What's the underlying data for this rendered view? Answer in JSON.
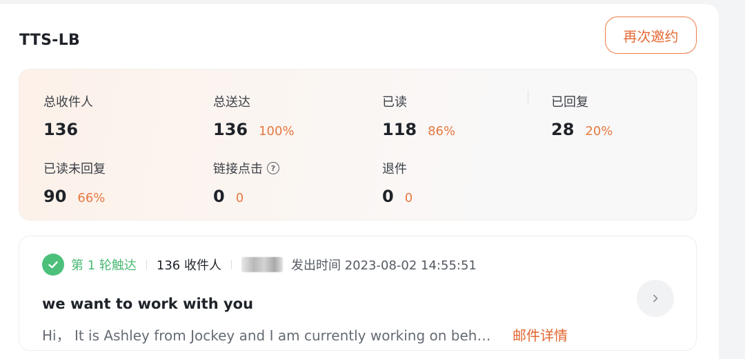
{
  "header": {
    "title": "TTS-LB",
    "reinvite_label": "再次邀约"
  },
  "stats": {
    "total_recipients": {
      "label": "总收件人",
      "value": "136"
    },
    "delivered": {
      "label": "总送达",
      "value": "136",
      "percent": "100%"
    },
    "read": {
      "label": "已读",
      "value": "118",
      "percent": "86%"
    },
    "replied": {
      "label": "已回复",
      "value": "28",
      "percent": "20%"
    },
    "read_no_reply": {
      "label": "已读未回复",
      "value": "90",
      "percent": "66%"
    },
    "link_clicks": {
      "label": "链接点击",
      "value": "0",
      "percent": "0",
      "help_icon": "question-circle-icon"
    },
    "bounced": {
      "label": "退件",
      "value": "0",
      "percent": "0"
    }
  },
  "round": {
    "status_icon": "check-circle-icon",
    "round_label": "第 1 轮触达",
    "recipients": "136 收件人",
    "send_time": "发出时间 2023-08-02 14:55:51",
    "subject": "we want to work with you",
    "preview": "Hi，  It is Ashley from Jockey and I am currently working on beh…",
    "detail_link": "邮件详情",
    "next_icon": "chevron-right-icon"
  },
  "colors": {
    "accent": "#e46a35",
    "success": "#4cc07b"
  }
}
